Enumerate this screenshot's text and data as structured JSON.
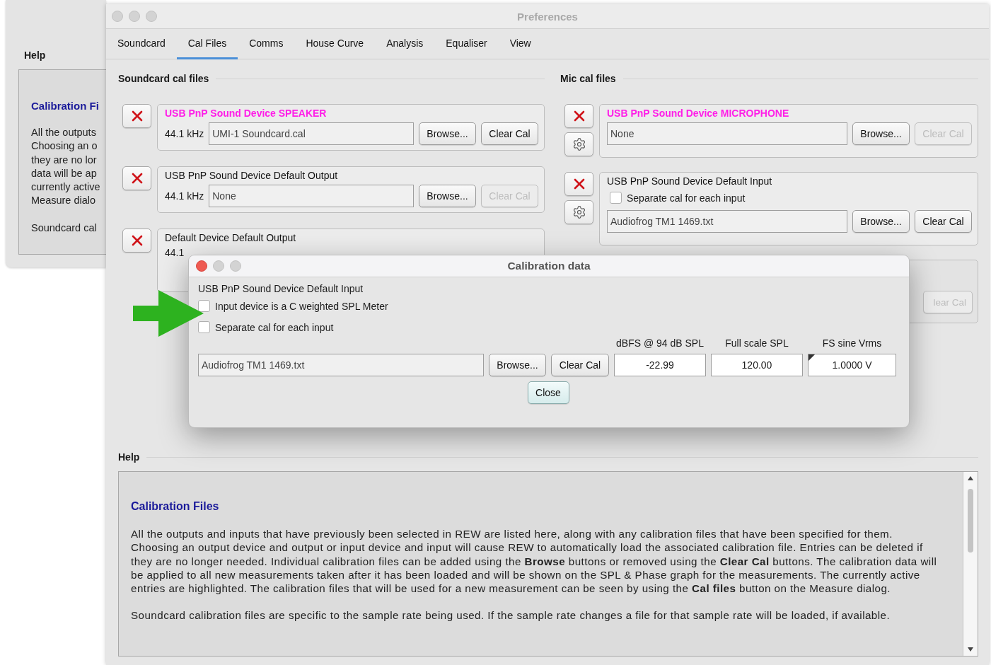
{
  "background_window": {
    "help_heading": "Help",
    "help_title": "Calibration Fi",
    "help_lines": [
      "All the outputs",
      "Choosing an o",
      "they are no lor",
      "data will be ap",
      "currently active",
      "Measure dialo"
    ],
    "help_line_2": "Soundcard cal"
  },
  "window": {
    "title": "Preferences"
  },
  "tabs": [
    {
      "label": "Soundcard",
      "selected": false
    },
    {
      "label": "Cal Files",
      "selected": true
    },
    {
      "label": "Comms",
      "selected": false
    },
    {
      "label": "House Curve",
      "selected": false
    },
    {
      "label": "Analysis",
      "selected": false
    },
    {
      "label": "Equaliser",
      "selected": false
    },
    {
      "label": "View",
      "selected": false
    }
  ],
  "soundcard_cal_files": {
    "heading": "Soundcard cal files",
    "entries": [
      {
        "kind": "full",
        "device": "USB PnP Sound Device SPEAKER",
        "active": true,
        "rate": "44.1 kHz",
        "file": "UMI-1 Soundcard.cal",
        "browse": "Browse...",
        "clear": "Clear Cal",
        "clear_disabled": false
      },
      {
        "kind": "full",
        "device": "USB PnP Sound Device Default Output",
        "active": false,
        "rate": "44.1 kHz",
        "file": "None",
        "browse": "Browse...",
        "clear": "Clear Cal",
        "clear_disabled": true
      },
      {
        "kind": "covered",
        "device": "Default Device Default Output",
        "active": false,
        "rate": "44.1"
      }
    ]
  },
  "mic_cal_files": {
    "heading": "Mic cal files",
    "entries": [
      {
        "kind": "file",
        "device": "USB PnP Sound Device MICROPHONE",
        "active": true,
        "file": "None",
        "browse": "Browse...",
        "clear": "Clear Cal",
        "clear_disabled": true
      },
      {
        "kind": "separate",
        "device": "USB PnP Sound Device Default Input",
        "active": false,
        "checkbox": {
          "label": "Separate cal for each input",
          "checked": false
        },
        "file": "Audiofrog TM1 1469.txt",
        "browse": "Browse...",
        "clear": "Clear Cal",
        "clear_disabled": false
      },
      {
        "kind": "covered",
        "clear": "lear Cal",
        "clear_disabled": true
      }
    ]
  },
  "dialog": {
    "title": "Calibration data",
    "device": "USB PnP Sound Device Default Input",
    "checkboxes": [
      {
        "label": "Input device is a C weighted SPL Meter",
        "checked": false
      },
      {
        "label": "Separate cal for each input",
        "checked": false
      }
    ],
    "file": "Audiofrog TM1 1469.txt",
    "browse": "Browse...",
    "clear": "Clear Cal",
    "values": [
      {
        "label": "dBFS @ 94 dB SPL",
        "value": "-22.99"
      },
      {
        "label": "Full scale SPL",
        "value": "120.00"
      },
      {
        "label": "FS sine Vrms",
        "value": "1.0000 V"
      }
    ],
    "close": "Close"
  },
  "help": {
    "heading": "Help",
    "title": "Calibration Files",
    "paragraphs": [
      "All the outputs and inputs that have previously been selected in REW are listed here, along with any calibration files that have been specified for them. Choosing an output device and output or input device and input will cause REW to automatically load the associated calibration file. Entries can be deleted if they are no longer needed. Individual calibration files can be added using the **Browse** buttons or removed using the **Clear Cal** buttons. The calibration data will be applied to all new measurements taken after it has been loaded and will be shown on the SPL & Phase graph for the measurements. The currently active entries are highlighted. The calibration files that will be used for a new measurement can be seen by using the **Cal files** button on the Measure dialog.",
      "Soundcard calibration files are specific to the sample rate being used. If the sample rate changes a file for that sample rate will be loaded, if available."
    ]
  }
}
